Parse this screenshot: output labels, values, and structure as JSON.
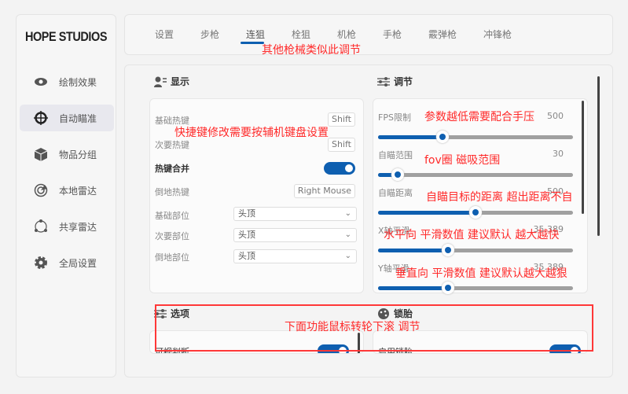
{
  "sidebar": {
    "logo": "HOPE STUDIOS",
    "items": [
      {
        "label": "绘制效果",
        "icon": "eye-icon"
      },
      {
        "label": "自动瞄准",
        "icon": "crosshair-icon",
        "active": true
      },
      {
        "label": "物品分组",
        "icon": "box-icon"
      },
      {
        "label": "本地雷达",
        "icon": "radar-icon"
      },
      {
        "label": "共享雷达",
        "icon": "share-icon"
      },
      {
        "label": "全局设置",
        "icon": "gear-icon"
      }
    ]
  },
  "tabs": [
    "设置",
    "步枪",
    "连狙",
    "栓狙",
    "机枪",
    "手枪",
    "霰弹枪",
    "冲锋枪"
  ],
  "active_tab": "连狙",
  "display": {
    "title": "显示",
    "rows": {
      "base_hotkey": "基础热键",
      "base_hotkey_val": "Shift",
      "sec_hotkey": "次要热键",
      "sec_hotkey_val": "Shift",
      "merge": "热键合并",
      "merge_on": true,
      "down_hotkey": "倒地热键",
      "down_hotkey_val": "Right Mouse",
      "base_part": "基础部位",
      "base_part_val": "头顶",
      "sec_part": "次要部位",
      "sec_part_val": "头顶",
      "down_part": "倒地部位",
      "down_part_val": "头顶"
    }
  },
  "adjust": {
    "title": "调节",
    "sliders": [
      {
        "label": "FPS限制",
        "value": "500",
        "fraction": 0.33
      },
      {
        "label": "自瞄范围",
        "value": "30",
        "fraction": 0.1
      },
      {
        "label": "自瞄距离",
        "value": "500",
        "fraction": 0.5
      },
      {
        "label": "X轴平滑",
        "value": "35.389",
        "fraction": 0.36
      },
      {
        "label": "Y轴平滑",
        "value": "35.389",
        "fraction": 0.36
      }
    ]
  },
  "options": {
    "title": "选项",
    "first_row": "可视判断"
  },
  "lock": {
    "title": "锁胎",
    "first_row": "启用锁胎"
  },
  "notes": {
    "tabs": "其他枪械类似此调节",
    "hotkey": "快捷键修改需要按辅机键盘设置",
    "fps": "参数越低需要配合手压",
    "fov": "fov圈 磁吸范围",
    "dist": "自瞄目标的距离 超出距离不自",
    "x": "水平向 平滑数值 建议默认 越大越快",
    "y": "垂直向 平滑数值 建议默认越大越狠",
    "scroll": "下面功能鼠标转轮下滚  调节"
  },
  "colors": {
    "accent": "#0e5fb0",
    "annotation": "#ff2a2a"
  }
}
